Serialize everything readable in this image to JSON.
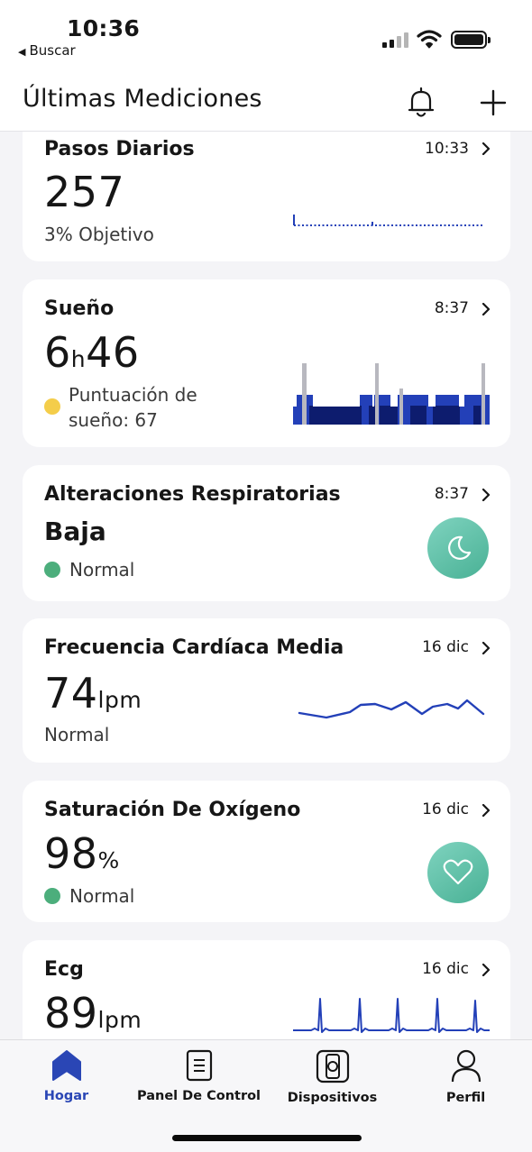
{
  "status_bar": {
    "time": "10:36",
    "back_label": "Buscar"
  },
  "header": {
    "title": "Últimas Mediciones",
    "bell_icon": "bell-icon",
    "add_icon": "plus-icon"
  },
  "cards": {
    "steps": {
      "title": "Pasos Diarios",
      "time": "10:33",
      "value": "257",
      "subtitle": "3% Objetivo"
    },
    "sleep": {
      "title": "Sueño",
      "time": "8:37",
      "hours": "6",
      "hours_unit": "h",
      "minutes": "46",
      "score_label": "Puntuación de sueño: 67",
      "dot_color": "#f4cd4a"
    },
    "breathing": {
      "title": "Alteraciones Respiratorias",
      "time": "8:37",
      "value": "Baja",
      "status": "Normal",
      "dot_color": "#4cae7c",
      "icon": "moon-icon"
    },
    "heart_rate": {
      "title": "Frecuencia Cardíaca Media",
      "time": "16 dic",
      "value": "74",
      "unit": "lpm",
      "status": "Normal"
    },
    "oxygen": {
      "title": "Saturación De Oxígeno",
      "time": "16 dic",
      "value": "98",
      "unit": "%",
      "status": "Normal",
      "dot_color": "#4cae7c",
      "icon": "heart-icon"
    },
    "ecg": {
      "title": "Ecg",
      "time": "16 dic",
      "value": "89",
      "unit": "lpm"
    }
  },
  "tabbar": {
    "tabs": [
      {
        "label": "Hogar",
        "icon": "home-icon",
        "active": true
      },
      {
        "label": "Panel De Control",
        "icon": "clipboard-icon",
        "active": false
      },
      {
        "label": "Dispositivos",
        "icon": "watch-icon",
        "active": false
      },
      {
        "label": "Perfil",
        "icon": "person-icon",
        "active": false
      }
    ]
  },
  "colors": {
    "accent": "#2a46b5",
    "chart_line": "#2340b8",
    "teal": "#5cc0a6"
  }
}
